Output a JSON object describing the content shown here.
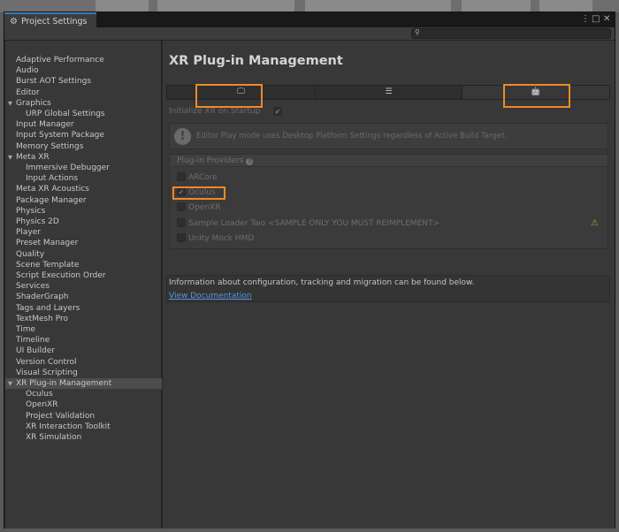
{
  "window": {
    "tab_title": "Project Settings",
    "tab_icon": "gear-icon",
    "controls": {
      "more": "⋮",
      "maximize": "□",
      "close": "✕"
    }
  },
  "search": {
    "placeholder": "",
    "icon": "search-icon"
  },
  "sidebar": {
    "items": [
      {
        "label": "Adaptive Performance"
      },
      {
        "label": "Audio"
      },
      {
        "label": "Burst AOT Settings"
      },
      {
        "label": "Editor"
      },
      {
        "label": "Graphics",
        "expanded": true
      },
      {
        "label": "URP Global Settings",
        "child": true
      },
      {
        "label": "Input Manager"
      },
      {
        "label": "Input System Package"
      },
      {
        "label": "Memory Settings"
      },
      {
        "label": "Meta XR",
        "expanded": true
      },
      {
        "label": "Immersive Debugger",
        "child": true
      },
      {
        "label": "Input Actions",
        "child": true
      },
      {
        "label": "Meta XR Acoustics"
      },
      {
        "label": "Package Manager"
      },
      {
        "label": "Physics"
      },
      {
        "label": "Physics 2D"
      },
      {
        "label": "Player"
      },
      {
        "label": "Preset Manager"
      },
      {
        "label": "Quality"
      },
      {
        "label": "Scene Template"
      },
      {
        "label": "Script Execution Order"
      },
      {
        "label": "Services"
      },
      {
        "label": "ShaderGraph"
      },
      {
        "label": "Tags and Layers"
      },
      {
        "label": "TextMesh Pro"
      },
      {
        "label": "Time"
      },
      {
        "label": "Timeline"
      },
      {
        "label": "UI Builder"
      },
      {
        "label": "Version Control"
      },
      {
        "label": "Visual Scripting"
      },
      {
        "label": "XR Plug-in Management",
        "expanded": true,
        "selected": true
      },
      {
        "label": "Oculus",
        "child": true
      },
      {
        "label": "OpenXR",
        "child": true
      },
      {
        "label": "Project Validation",
        "child": true
      },
      {
        "label": "XR Interaction Toolkit",
        "child": true
      },
      {
        "label": "XR Simulation",
        "child": true
      }
    ]
  },
  "main": {
    "title": "XR Plug-in Management",
    "platform_tabs": [
      {
        "icon": "monitor-icon",
        "glyph": "🖵",
        "active": false
      },
      {
        "icon": "sliders-icon",
        "glyph": "☰",
        "active": false
      },
      {
        "icon": "android-icon",
        "glyph": "🤖",
        "active": true
      }
    ],
    "init_label": "Initialize XR on Startup",
    "init_checked": true,
    "help_text": "Editor Play mode uses Desktop Platform Settings regardless of Active Build Target.",
    "providers_header": "Plug-in Providers",
    "providers": [
      {
        "label": "ARCore",
        "checked": false,
        "warning": false
      },
      {
        "label": "Oculus",
        "checked": true,
        "warning": false
      },
      {
        "label": "OpenXR",
        "checked": false,
        "warning": false
      },
      {
        "label": "Sample Loader Two <SAMPLE ONLY YOU MUST REIMPLEMENT>",
        "checked": false,
        "warning": true
      },
      {
        "label": "Unity Mock HMD",
        "checked": false,
        "warning": false
      }
    ],
    "info_text": "Information about configuration, tracking and migration can be found below.",
    "doc_link": "View Documentation"
  },
  "colors": {
    "highlight": "#f08a24",
    "link": "#5596e6",
    "tab_accent": "#3a79bb"
  }
}
